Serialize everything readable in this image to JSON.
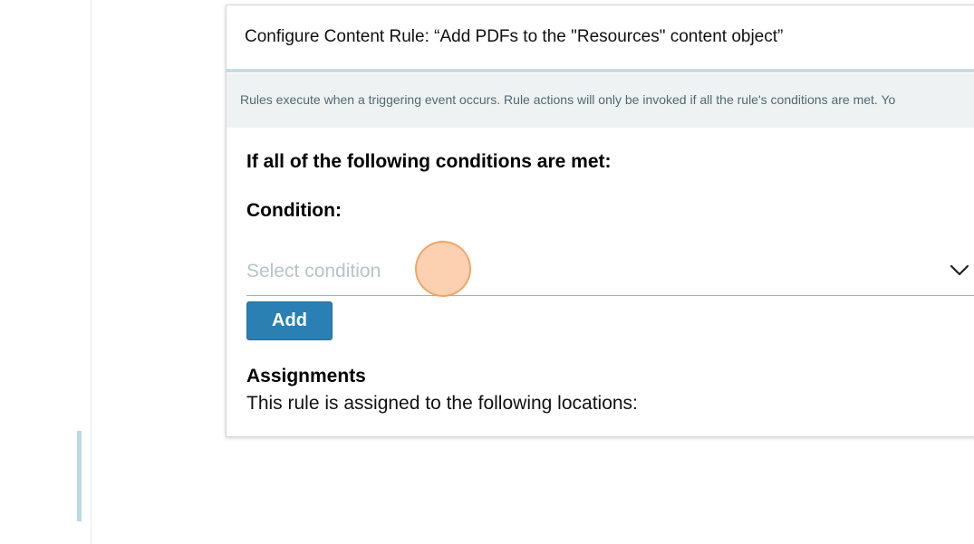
{
  "modal": {
    "title": "Configure Content Rule: “Add PDFs to the \"Resources\" content object”",
    "info_text": "Rules execute when a triggering event occurs. Rule actions will only be invoked if all the rule's conditions are met. Yo"
  },
  "conditions": {
    "heading": "If all of the following conditions are met:",
    "label": "Condition:",
    "select_placeholder": "Select condition",
    "add_label": "Add"
  },
  "assignments": {
    "heading": "Assignments",
    "description": "This rule is assigned to the following locations:"
  },
  "icons": {
    "select_chevron": "chevron-down-icon"
  },
  "colors": {
    "accent": "#2a7fb3",
    "info_bar_bg": "#eef2f3",
    "info_text": "#4e6a73",
    "header_rule": "#c6dde3",
    "click_indicator": "#fab987"
  }
}
